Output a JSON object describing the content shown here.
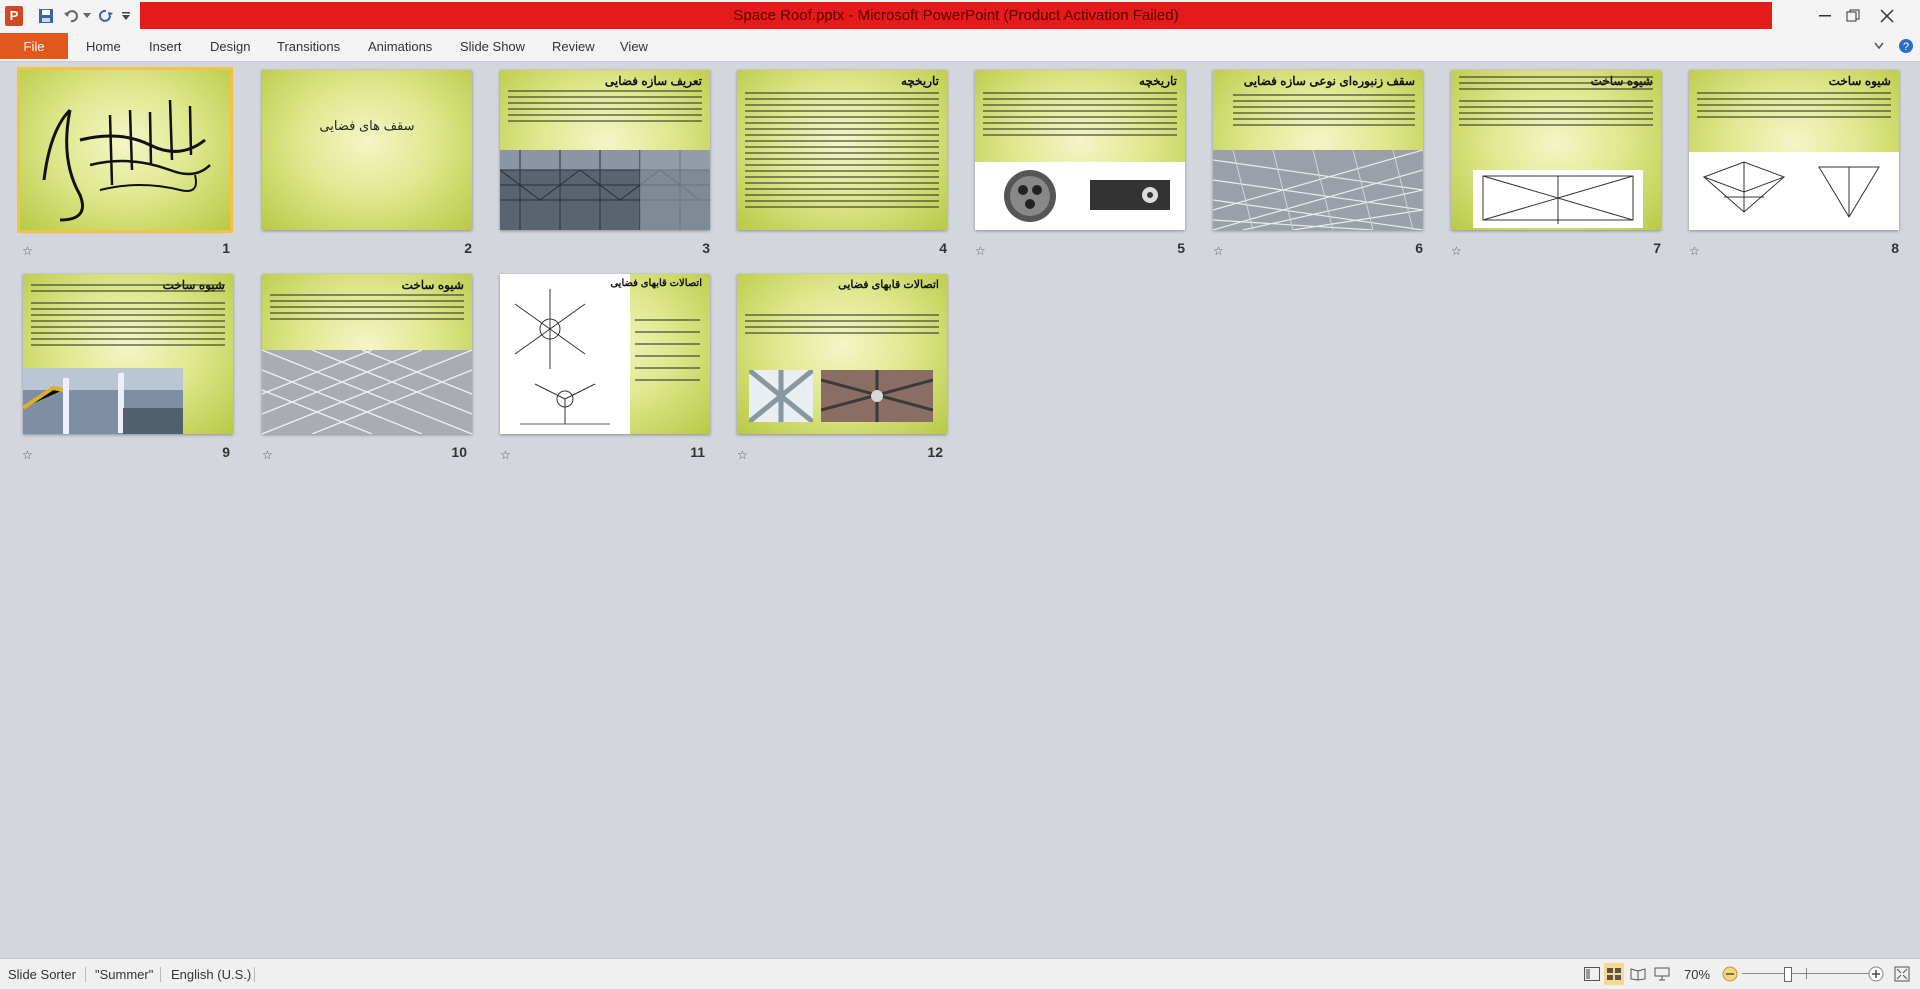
{
  "window": {
    "title": "Space Roof.pptx  -  Microsoft PowerPoint (Product Activation Failed)",
    "app_icon": "powerpoint-icon",
    "accent": "#e51b1b"
  },
  "ribbon": {
    "file_label": "File",
    "tabs": [
      "Home",
      "Insert",
      "Design",
      "Transitions",
      "Animations",
      "Slide Show",
      "Review",
      "View"
    ]
  },
  "slides": [
    {
      "number": "1",
      "title": "",
      "kind": "calligraphy"
    },
    {
      "number": "2",
      "title": "سقف های فضایی",
      "kind": "title"
    },
    {
      "number": "3",
      "title": "تعریف سازه فضایی",
      "kind": "text-photo"
    },
    {
      "number": "4",
      "title": "تاریخچه",
      "kind": "text"
    },
    {
      "number": "5",
      "title": "تاریخچه",
      "kind": "text-nodes"
    },
    {
      "number": "6",
      "title": "سقف زنبوره‌ای نوعی سازه فضایی",
      "kind": "text-photo"
    },
    {
      "number": "7",
      "title": "شیوه ساخت",
      "kind": "text-diagram"
    },
    {
      "number": "8",
      "title": "شیوه ساخت",
      "kind": "text-diagram"
    },
    {
      "number": "9",
      "title": "شیوه ساخت",
      "kind": "text-photo"
    },
    {
      "number": "10",
      "title": "شیوه ساخت",
      "kind": "text-photo"
    },
    {
      "number": "11",
      "title": "اتصالات قابهای فضایی",
      "kind": "diagram-text"
    },
    {
      "number": "12",
      "title": "اتصالات قابهای فضایی",
      "kind": "text-photo"
    }
  ],
  "statusbar": {
    "view": "Slide Sorter",
    "theme": "\"Summer\"",
    "language": "English (U.S.)",
    "zoom": "70%"
  }
}
